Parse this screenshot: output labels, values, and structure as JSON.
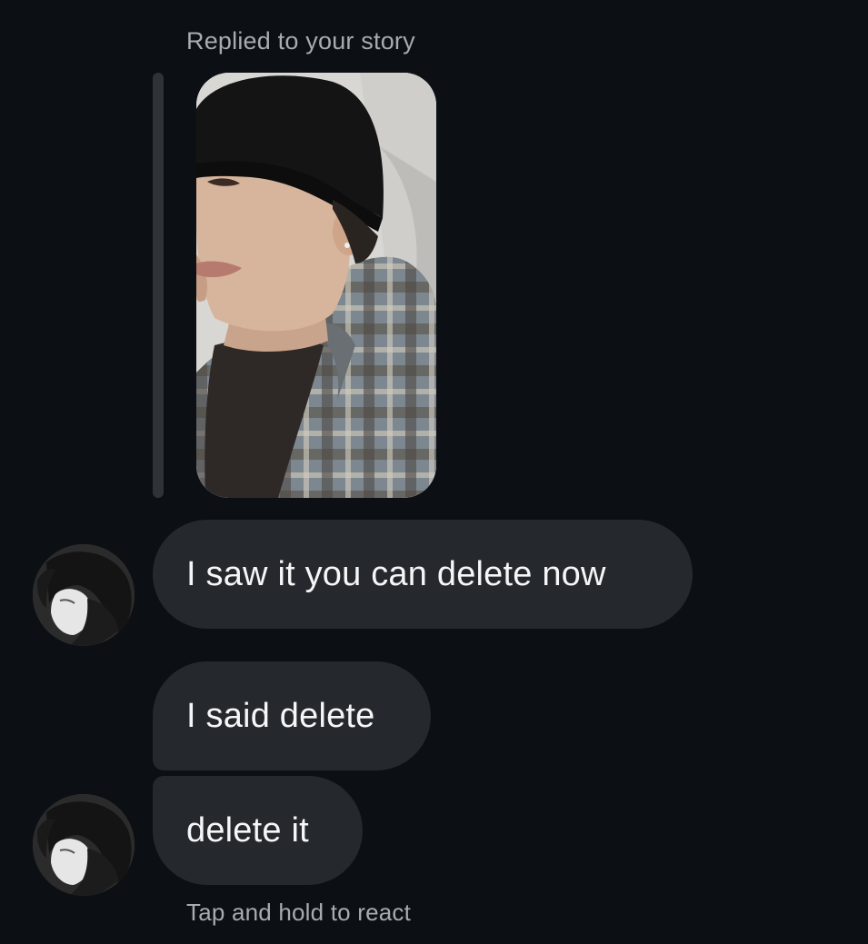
{
  "thread": {
    "reply_caption": "Replied to your story",
    "story": {
      "image": "story-photo",
      "accent_wall": "#d7d6d3"
    },
    "messages": [
      {
        "text": "I saw it you can delete now",
        "avatar": true
      },
      {
        "text": "I said delete",
        "avatar": false
      },
      {
        "text": "delete it",
        "avatar": true
      }
    ],
    "react_hint": "Tap and hold to react"
  },
  "colors": {
    "background": "#0c1014",
    "bubble": "#25282d",
    "text": "#f5f6f7",
    "muted_text": "#a8acb2"
  }
}
